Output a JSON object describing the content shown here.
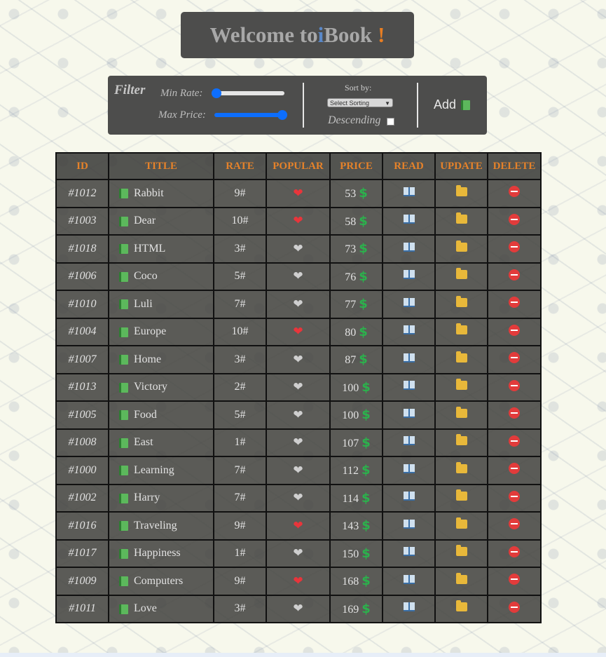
{
  "header": {
    "prefix": "Welcome to ",
    "brand_i": "i",
    "brand_rest": "Book",
    "bang": "!"
  },
  "filter": {
    "title": "Filter",
    "min_rate_label": "Min Rate:",
    "max_price_label": "Max Price:",
    "min_rate_value": 0,
    "max_price_value": 1,
    "sort_label": "Sort by:",
    "sort_select": "Select Sorting",
    "descending_label": "Descending",
    "descending_checked": false,
    "add_label": "Add",
    "add_icon": "green-book-icon"
  },
  "table": {
    "headers": {
      "id": "ID",
      "title": "TITLE",
      "rate": "RATE",
      "popular": "POPULAR",
      "price": "PRICE",
      "read": "READ",
      "update": "UPDATE",
      "delete": "DELETE"
    },
    "rows": [
      {
        "id": "#1012",
        "title": "Rabbit",
        "rate": "9#",
        "popular": true,
        "price": "53"
      },
      {
        "id": "#1003",
        "title": "Dear",
        "rate": "10#",
        "popular": true,
        "price": "58"
      },
      {
        "id": "#1018",
        "title": "HTML",
        "rate": "3#",
        "popular": false,
        "price": "73"
      },
      {
        "id": "#1006",
        "title": "Coco",
        "rate": "5#",
        "popular": false,
        "price": "76"
      },
      {
        "id": "#1010",
        "title": "Luli",
        "rate": "7#",
        "popular": false,
        "price": "77"
      },
      {
        "id": "#1004",
        "title": "Europe",
        "rate": "10#",
        "popular": true,
        "price": "80"
      },
      {
        "id": "#1007",
        "title": "Home",
        "rate": "3#",
        "popular": false,
        "price": "87"
      },
      {
        "id": "#1013",
        "title": "Victory",
        "rate": "2#",
        "popular": false,
        "price": "100"
      },
      {
        "id": "#1005",
        "title": "Food",
        "rate": "5#",
        "popular": false,
        "price": "100"
      },
      {
        "id": "#1008",
        "title": "East",
        "rate": "1#",
        "popular": false,
        "price": "107"
      },
      {
        "id": "#1000",
        "title": "Learning",
        "rate": "7#",
        "popular": false,
        "price": "112"
      },
      {
        "id": "#1002",
        "title": "Harry",
        "rate": "7#",
        "popular": false,
        "price": "114"
      },
      {
        "id": "#1016",
        "title": "Traveling",
        "rate": "9#",
        "popular": true,
        "price": "143"
      },
      {
        "id": "#1017",
        "title": "Happiness",
        "rate": "1#",
        "popular": false,
        "price": "150"
      },
      {
        "id": "#1009",
        "title": "Computers",
        "rate": "9#",
        "popular": true,
        "price": "168"
      },
      {
        "id": "#1011",
        "title": "Love",
        "rate": "3#",
        "popular": false,
        "price": "169"
      }
    ],
    "currency_icon": "dollar-icon",
    "read_icon": "open-book-icon",
    "update_icon": "folder-icon",
    "delete_icon": "no-entry-icon"
  },
  "colors": {
    "accent_orange": "#e5822a",
    "brand_blue": "#5a88c8",
    "panel_gray": "#4d4d4c",
    "heart_red": "#e8353b",
    "dollar_green": "#2bb24c",
    "slider_blue": "#0d6efd"
  }
}
